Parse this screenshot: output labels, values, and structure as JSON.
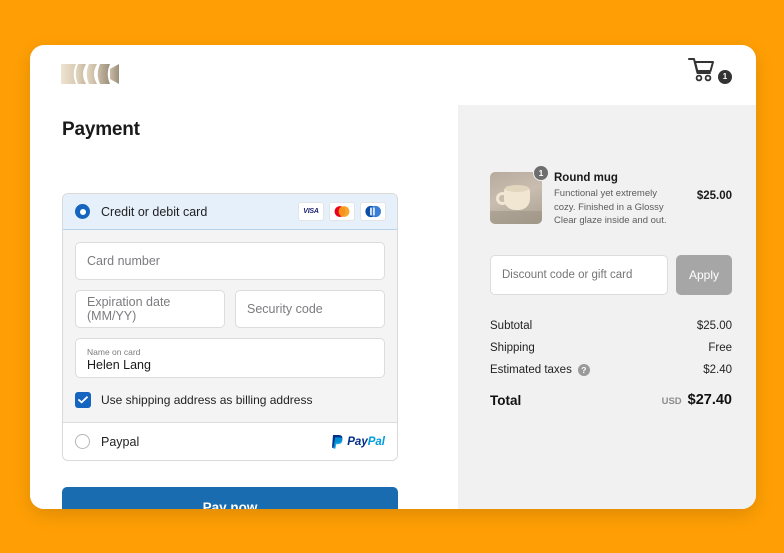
{
  "header": {
    "logo_name": "brand-logo",
    "cart_icon": "shopping-cart-icon",
    "cart_count": "1"
  },
  "payment": {
    "title": "Payment",
    "methods": [
      {
        "id": "card",
        "label": "Credit or debit card",
        "selected": true,
        "brands": [
          "VISA",
          "mastercard",
          "diners-club"
        ]
      },
      {
        "id": "paypal",
        "label": "Paypal",
        "selected": false,
        "logo_pay": "Pay",
        "logo_pal": "Pal"
      }
    ],
    "fields": {
      "card_number_placeholder": "Card number",
      "card_number_value": "",
      "expiration_placeholder": "Expiration date (MM/YY)",
      "expiration_value": "",
      "security_placeholder": "Security code",
      "security_value": "",
      "name_label": "Name on card",
      "name_value": "Helen Lang"
    },
    "billing_checkbox_label": "Use shipping address as billing address",
    "billing_checkbox_checked": true,
    "pay_button_label": "Pay now"
  },
  "summary": {
    "item": {
      "title": "Round mug",
      "description": "Functional yet extremely cozy. Finished in a Glossy Clear glaze inside and out.",
      "price": "$25.00",
      "quantity": "1",
      "image_name": "round-mug-photo"
    },
    "discount": {
      "placeholder": "Discount code or gift card",
      "value": "",
      "apply_label": "Apply"
    },
    "lines": [
      {
        "label": "Subtotal",
        "value": "$25.00",
        "help": false
      },
      {
        "label": "Shipping",
        "value": "Free",
        "help": false
      },
      {
        "label": "Estimated taxes",
        "value": "$2.40",
        "help": true,
        "help_glyph": "?"
      }
    ],
    "total": {
      "label": "Total",
      "currency": "USD",
      "amount": "$27.40"
    }
  },
  "colors": {
    "page_background": "#FF9F05",
    "primary_button": "#1a6cb0",
    "accent_blue": "#1565c0",
    "selected_row": "#e6f0fb",
    "panel_background": "#f1f1f1",
    "apply_button": "#a6a6a6"
  }
}
